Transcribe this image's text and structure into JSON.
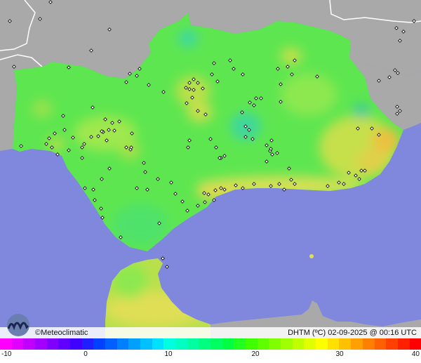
{
  "credit": "©Meteoclimatic",
  "caption": "DHTM (ºC)  02-09-2025 @ 00:16 UTC",
  "scale": {
    "ticks": [
      "-10",
      "0",
      "10",
      "20",
      "30",
      "40"
    ],
    "colors": [
      "#ff00ff",
      "#e000ff",
      "#c000ff",
      "#a000ff",
      "#8000ff",
      "#6000ff",
      "#4000ff",
      "#2020ff",
      "#0040ff",
      "#0060ff",
      "#0080ff",
      "#00a0ff",
      "#00c0ff",
      "#00e0ff",
      "#00ffe0",
      "#00ffc0",
      "#00ffa0",
      "#00ff80",
      "#00ff60",
      "#00ff40",
      "#20ff20",
      "#40ff00",
      "#60ff00",
      "#80ff00",
      "#a0ff00",
      "#c0ff00",
      "#e0ff00",
      "#ffff00",
      "#ffe000",
      "#ffc000",
      "#ffa000",
      "#ff8000",
      "#ff6000",
      "#ff4000",
      "#ff2000",
      "#ff0000"
    ]
  },
  "colors": {
    "sea": "#7f88dd",
    "foreign_land": "#a9a9a9",
    "land_base": "#5ee650",
    "warm": "#d8e655",
    "hot": "#f0b040",
    "cool": "#40d8a0"
  }
}
